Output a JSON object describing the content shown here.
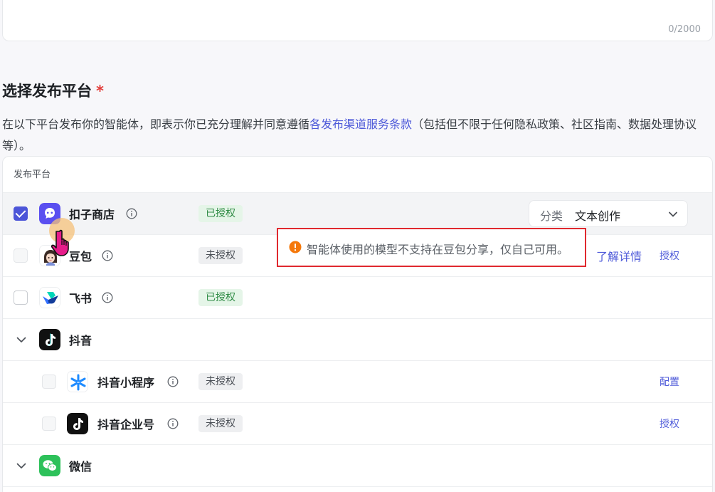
{
  "description_field": {
    "char_count": "0/2000"
  },
  "publish_section": {
    "title": "选择发布平台",
    "required_mark": "*",
    "desc_before": "在以下平台发布你的智能体，即表示你已充分理解并同意遵循",
    "desc_link": "各发布渠道服务条款",
    "desc_after": "（包括但不限于任何隐私政策、社区指南、数据处理协议等）。"
  },
  "table": {
    "header": "发布平台",
    "rows": [
      {
        "name": "扣子商店",
        "status": "已授权",
        "checked": true,
        "category_label": "分类",
        "category_value": "文本创作"
      },
      {
        "name": "豆包",
        "status": "未授权",
        "warning": "智能体使用的模型不支持在豆包分享，仅自己可用。",
        "learn_more": "了解详情",
        "action": "授权"
      },
      {
        "name": "飞书",
        "status": "已授权"
      },
      {
        "name": "抖音"
      },
      {
        "name": "抖音小程序",
        "status": "未授权",
        "action": "配置"
      },
      {
        "name": "抖音企业号",
        "status": "未授权",
        "action": "授权"
      },
      {
        "name": "微信"
      }
    ]
  },
  "colors": {
    "accent": "#4e5ad9",
    "checkbox_checked": "#4c55d8",
    "authorized_bg": "#e5f5e8",
    "authorized_text": "#2d8a43",
    "warning_orange": "#f5780a",
    "highlight_border": "#e0292f",
    "required_star": "#e23c39"
  },
  "icons": {
    "coze_store": "coze-store-icon",
    "doubao": "doubao-avatar-icon",
    "feishu": "feishu-icon",
    "douyin": "douyin-icon",
    "douyin_mini": "douyin-mini-program-icon",
    "wechat": "wechat-icon",
    "info": "info-icon",
    "warning": "warning-icon",
    "expand": "chevron-down-icon",
    "cursor": "hand-pointer-cursor-icon"
  }
}
